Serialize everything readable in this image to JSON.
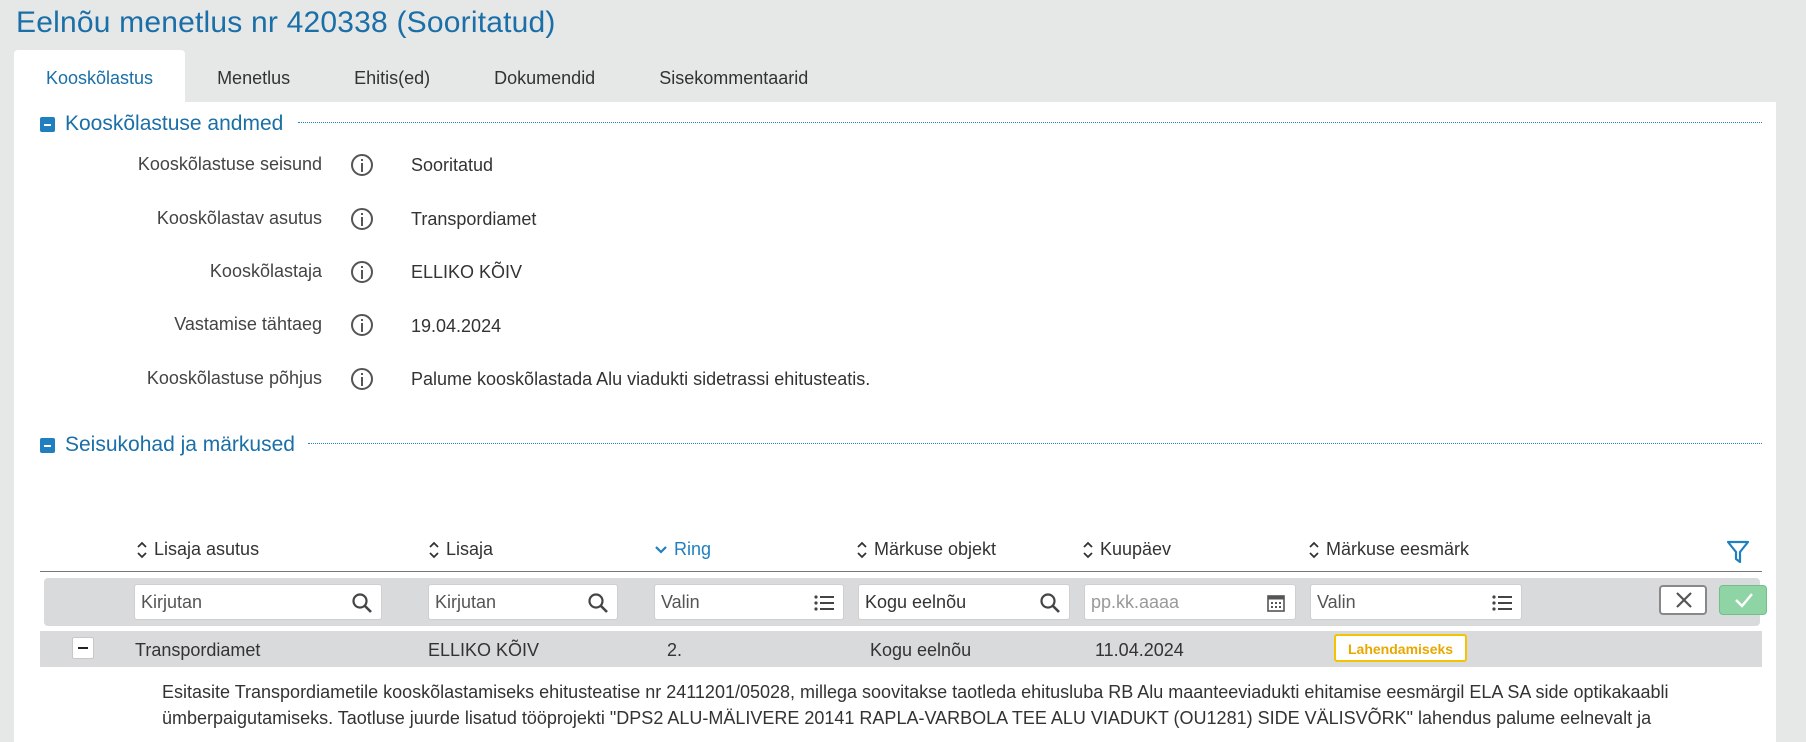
{
  "page": {
    "title": "Eelnõu menetlus nr 420338 (Sooritatud)"
  },
  "tabs": [
    {
      "label": "Kooskõlastus",
      "active": true
    },
    {
      "label": "Menetlus"
    },
    {
      "label": "Ehitis(ed)"
    },
    {
      "label": "Dokumendid"
    },
    {
      "label": "Sisekommentaarid"
    }
  ],
  "section_details": {
    "title": "Kooskõlastuse andmed",
    "fields": [
      {
        "label": "Kooskõlastuse seisund",
        "value": "Sooritatud"
      },
      {
        "label": "Kooskõlastav asutus",
        "value": "Transpordiamet"
      },
      {
        "label": "Kooskõlastaja",
        "value": "ELLIKO KÕIV"
      },
      {
        "label": "Vastamise tähtaeg",
        "value": "19.04.2024"
      },
      {
        "label": "Kooskõlastuse põhjus",
        "value": "Palume kooskõlastada Alu viadukti sidetrassi ehitusteatis."
      }
    ]
  },
  "section_remarks": {
    "title": "Seisukohad ja märkused",
    "columns": [
      {
        "label": "Lisaja asutus"
      },
      {
        "label": "Lisaja"
      },
      {
        "label": "Ring",
        "sorted": true
      },
      {
        "label": "Märkuse objekt"
      },
      {
        "label": "Kuupäev"
      },
      {
        "label": "Märkuse eesmärk"
      }
    ],
    "filters": [
      {
        "placeholder": "Kirjutan"
      },
      {
        "placeholder": "Kirjutan"
      },
      {
        "placeholder": "Valin"
      },
      {
        "value": "Kogu eelnõu"
      },
      {
        "placeholder": "pp.kk.aaaa"
      },
      {
        "placeholder": "Valin"
      }
    ],
    "row": {
      "agency": "Transpordiamet",
      "author": "ELLIKO KÕIV",
      "round": "2.",
      "object": "Kogu eelnõu",
      "date": "11.04.2024",
      "purpose": "Lahendamiseks",
      "text": "Esitasite Transpordiametile kooskõlastamiseks ehitusteatise nr 2411201/05028, millega soovitakse taotleda ehitusluba RB Alu maanteeviadukti ehitamise eesmärgil ELA SA side optikakaabli ümberpaigutamiseks. Taotluse juurde lisatud tööprojekti \"DPS2 ALU-MÄLIVERE 20141 RAPLA-VARBOLA TEE ALU VIADUKT (OU1281) SIDE VÄLISVÕRK\" lahendus palume eelnevalt ja"
    }
  },
  "colors": {
    "accent": "#1a6fa8",
    "badge": "#f4c400",
    "apply": "#8fd4a4"
  }
}
